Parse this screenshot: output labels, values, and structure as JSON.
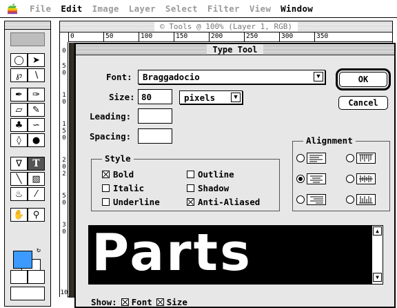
{
  "menubar": {
    "apple_icon": "apple-icon",
    "items": [
      {
        "label": "File",
        "active": false
      },
      {
        "label": "Edit",
        "active": true
      },
      {
        "label": "Image",
        "active": false
      },
      {
        "label": "Layer",
        "active": false
      },
      {
        "label": "Select",
        "active": false
      },
      {
        "label": "Filter",
        "active": false
      },
      {
        "label": "View",
        "active": false
      },
      {
        "label": "Window",
        "active": true
      }
    ]
  },
  "document": {
    "title": "© Tools @ 100% (Layer 1, RGB)",
    "ruler_ticks": [
      "0",
      "50",
      "100",
      "150",
      "200",
      "250",
      "300",
      "350"
    ],
    "vruler_ticks": [
      "0",
      "5",
      "0",
      "1",
      "0",
      "1",
      "5",
      "0",
      "2",
      "0",
      "2",
      "5",
      "0",
      "3",
      "0",
      "10"
    ]
  },
  "toolbox": {
    "foreground_color": "#3d9bff",
    "background_color": "#ffffff",
    "tools": [
      "marquee-icon",
      "move-icon",
      "lasso-icon",
      "magic-wand-icon",
      "airbrush-icon",
      "paintbrush-icon",
      "eraser-icon",
      "pencil-icon",
      "rubber-stamp-icon",
      "smudge-icon",
      "blur-icon",
      "burn-icon",
      "pen-icon",
      "type-icon",
      "line-icon",
      "gradient-icon",
      "paint-bucket-icon",
      "eyedropper-icon",
      "hand-icon",
      "zoom-icon"
    ]
  },
  "dialog": {
    "title": "Type Tool",
    "font_label": "Font:",
    "font_value": "Braggadocio",
    "size_label": "Size:",
    "size_value": "80",
    "size_unit": "pixels",
    "leading_label": "Leading:",
    "leading_value": "",
    "spacing_label": "Spacing:",
    "spacing_value": "",
    "ok_label": "OK",
    "cancel_label": "Cancel",
    "style": {
      "title": "Style",
      "options": [
        {
          "label": "Bold",
          "checked": true
        },
        {
          "label": "Outline",
          "checked": false
        },
        {
          "label": "Italic",
          "checked": false
        },
        {
          "label": "Shadow",
          "checked": false
        },
        {
          "label": "Underline",
          "checked": false
        },
        {
          "label": "Anti-Aliased",
          "checked": true
        }
      ]
    },
    "alignment": {
      "title": "Alignment",
      "selected": "center"
    },
    "preview_text": "Parts",
    "show_label": "Show:",
    "show_font_label": "Font",
    "show_size_label": "Size",
    "show_font_checked": true,
    "show_size_checked": true
  }
}
